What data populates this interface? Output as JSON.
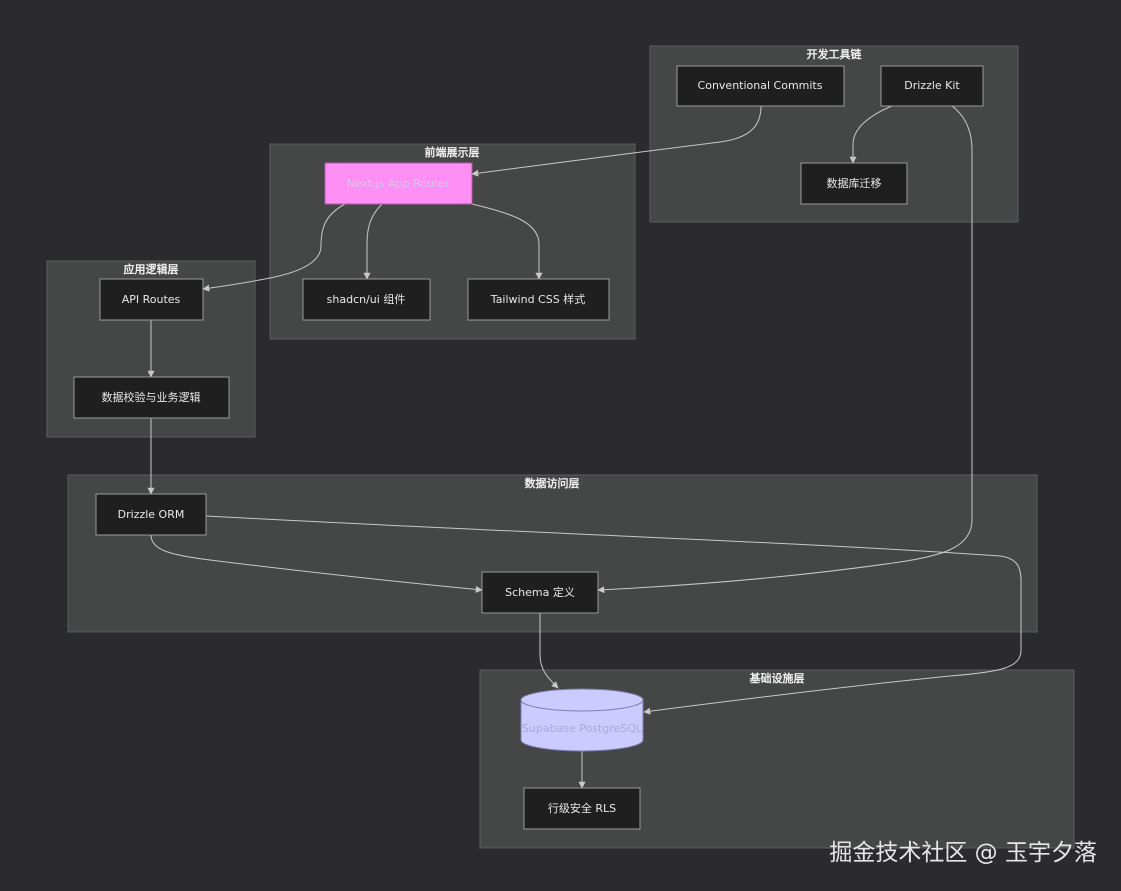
{
  "clusters": {
    "devtools": "开发工具链",
    "frontend": "前端展示层",
    "app": "应用逻辑层",
    "data": "数据访问层",
    "infra": "基础设施层"
  },
  "nodes": {
    "commits": "Conventional Commits",
    "drizzle_kit": "Drizzle Kit",
    "migration": "数据库迁移",
    "nextjs": "Next.js App Router",
    "shadcn": "shadcn/ui 组件",
    "tailwind": "Tailwind CSS 样式",
    "api": "API Routes",
    "validation": "数据校验与业务逻辑",
    "orm": "Drizzle ORM",
    "schema": "Schema 定义",
    "database": "Supabase PostgreSQL",
    "rls": "行级安全 RLS"
  },
  "colors": {
    "background": "#2b2b2d",
    "cluster": "#454646",
    "node": "#1f1f1f",
    "highlight_node": "#ff8ff5",
    "database": "#cbcbff"
  },
  "watermark": "掘金技术社区 @ 玉宇夕落"
}
